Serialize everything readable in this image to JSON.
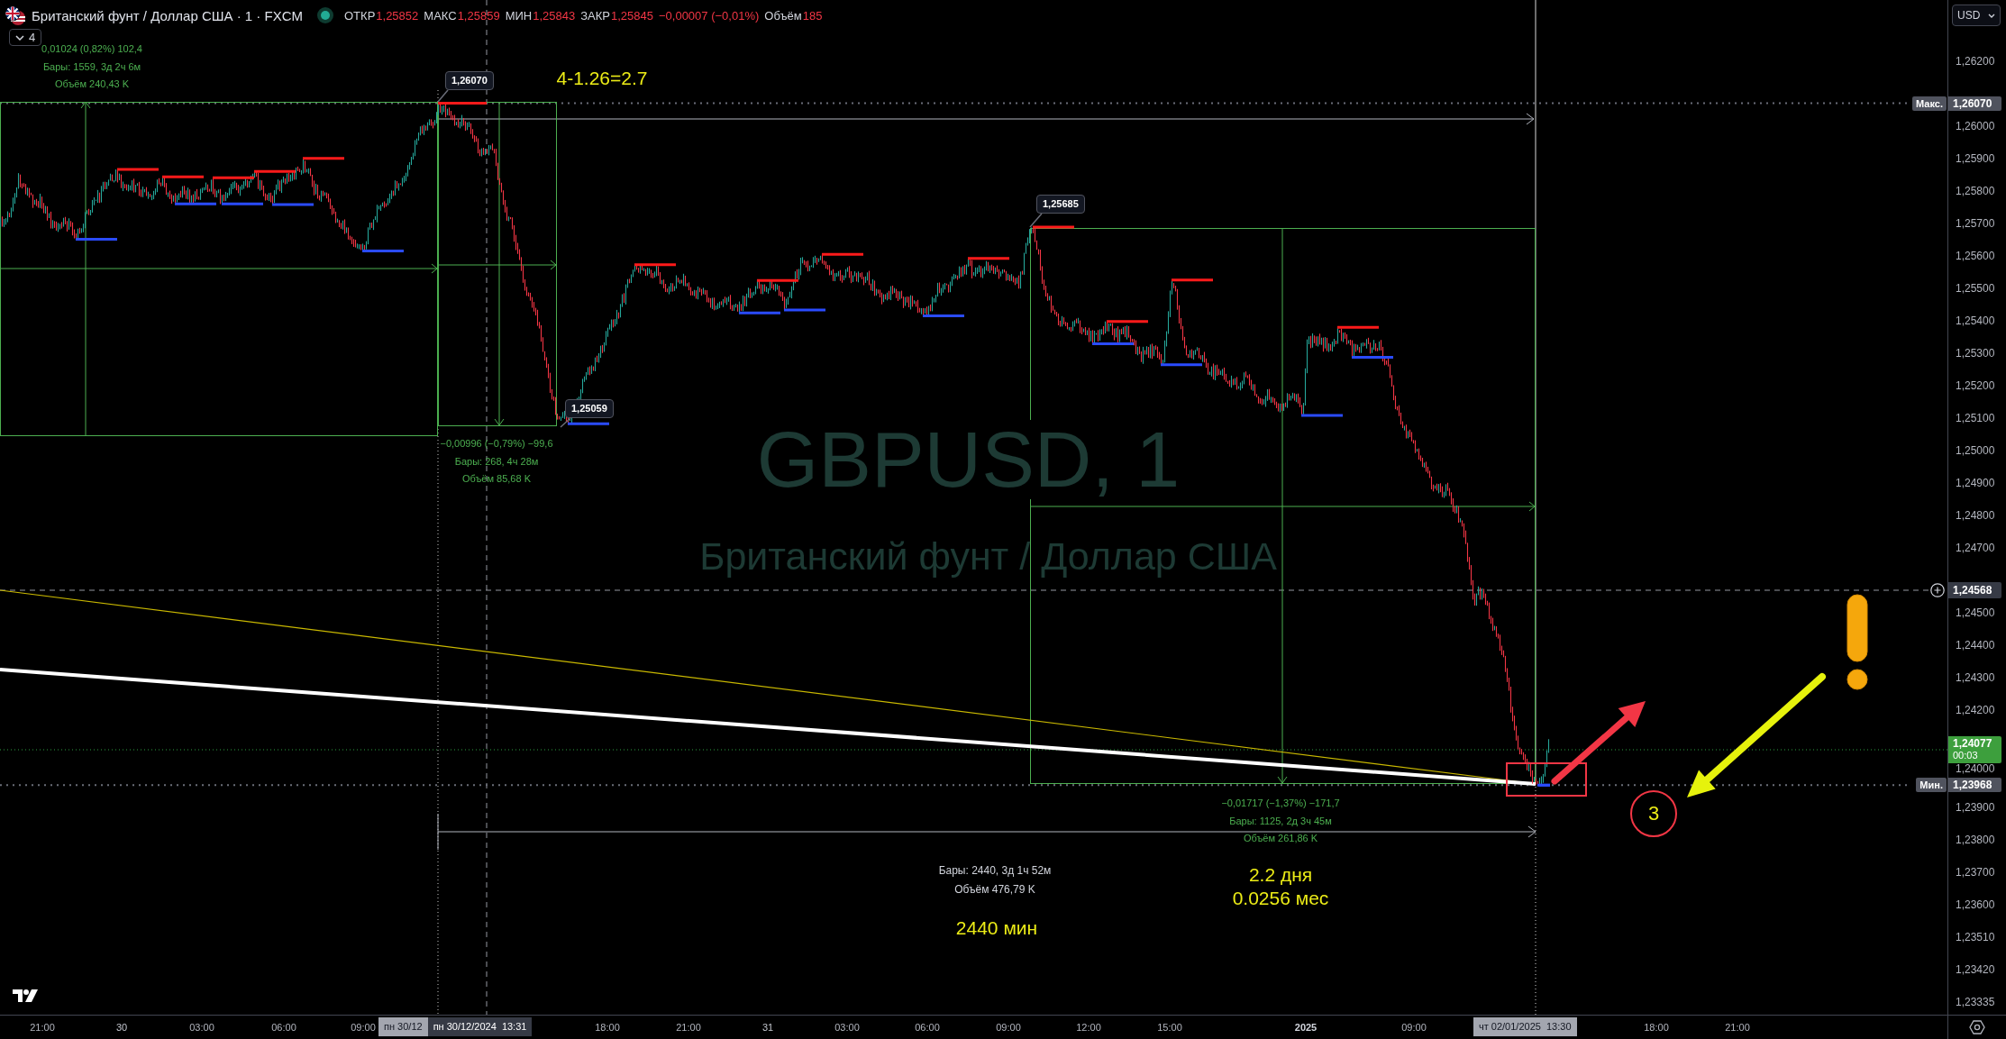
{
  "header": {
    "title": "Британский фунт / Доллар США · 1 · FXCM",
    "market_open": true,
    "quote": [
      {
        "label": "ОТКР",
        "value": "1,25852"
      },
      {
        "label": "МАКС",
        "value": "1,25859"
      },
      {
        "label": "МИН",
        "value": "1,25843"
      },
      {
        "label": "ЗАКР",
        "value": "1,25845"
      }
    ],
    "change": "−0,00007 (−0,01%)",
    "volume_label": "Объём",
    "volume": "185"
  },
  "indicators_button": {
    "label": "4"
  },
  "watermark": {
    "symbol": "GBPUSD, 1",
    "description": "Британский фунт / Доллар США"
  },
  "price_callouts": [
    "1,26070",
    "1,25685",
    "1,25059"
  ],
  "measurements": [
    {
      "kind": "price_range",
      "lines": [
        "0,01024 (0,82%) 102,4",
        "Бары: 1559, 3д 2ч 6м",
        "Объём 240,43 K"
      ]
    },
    {
      "kind": "price_range",
      "lines": [
        "−0,00996 (−0,79%) −99,6",
        "Бары: 268, 4ч 28м",
        "Объём 85,68 K"
      ]
    },
    {
      "kind": "price_range",
      "lines": [
        "−0,01717 (−1,37%) −171,7",
        "Бары: 1125, 2д 3ч 45м",
        "Объём 261,86 K"
      ]
    },
    {
      "kind": "date_range",
      "lines": [
        "Бары: 2440, 3д 1ч 52м",
        "Объём 476,79 K"
      ]
    }
  ],
  "notes": [
    {
      "lines": [
        "4-1.26=2.7"
      ]
    },
    {
      "lines": [
        "2.2 дня",
        "0.0256 мес"
      ]
    },
    {
      "lines": [
        "2440 мин"
      ]
    }
  ],
  "callout": {
    "number": "3"
  },
  "price_axis": {
    "currency": "USD",
    "ticks": [
      "1,26200",
      "1,26000",
      "1,25900",
      "1,25800",
      "1,25700",
      "1,25600",
      "1,25500",
      "1,25400",
      "1,25300",
      "1,25200",
      "1,25100",
      "1,25000",
      "1,24900",
      "1,24800",
      "1,24700",
      "1,24500",
      "1,24400",
      "1,24300",
      "1,24200",
      "1,24000",
      "1,23900",
      "1,23800",
      "1,23700",
      "1,23600",
      "1,23510",
      "1,23420",
      "1,23335"
    ],
    "labels": [
      {
        "kind": "max",
        "tag": "Макс.",
        "value": "1,26070"
      },
      {
        "kind": "crosshair",
        "value": "1,24568"
      },
      {
        "kind": "last",
        "value": "1,24077",
        "countdown": "00:03"
      },
      {
        "kind": "min",
        "tag": "Мин.",
        "value": "1,23968"
      }
    ]
  },
  "time_axis": {
    "labels": [
      {
        "text": "21:00",
        "kind": "time"
      },
      {
        "text": "30",
        "kind": "day"
      },
      {
        "text": "03:00",
        "kind": "time"
      },
      {
        "text": "06:00",
        "kind": "time"
      },
      {
        "text": "09:00",
        "kind": "time"
      },
      {
        "text": "18:00",
        "kind": "time"
      },
      {
        "text": "21:00",
        "kind": "time"
      },
      {
        "text": "31",
        "kind": "day"
      },
      {
        "text": "03:00",
        "kind": "time"
      },
      {
        "text": "06:00",
        "kind": "time"
      },
      {
        "text": "09:00",
        "kind": "time"
      },
      {
        "text": "12:00",
        "kind": "time"
      },
      {
        "text": "15:00",
        "kind": "time"
      },
      {
        "text": "2025",
        "kind": "year"
      },
      {
        "text": "09:00",
        "kind": "time"
      },
      {
        "text": "18:00",
        "kind": "time"
      },
      {
        "text": "21:00",
        "kind": "time"
      }
    ],
    "markers": [
      {
        "text": "пн 30/12",
        "kind": "range"
      },
      {
        "text": "пн 30/12/2024  13:31",
        "kind": "crosshair"
      },
      {
        "text": "чт 02/01/2025  13:30",
        "kind": "range"
      }
    ]
  }
}
